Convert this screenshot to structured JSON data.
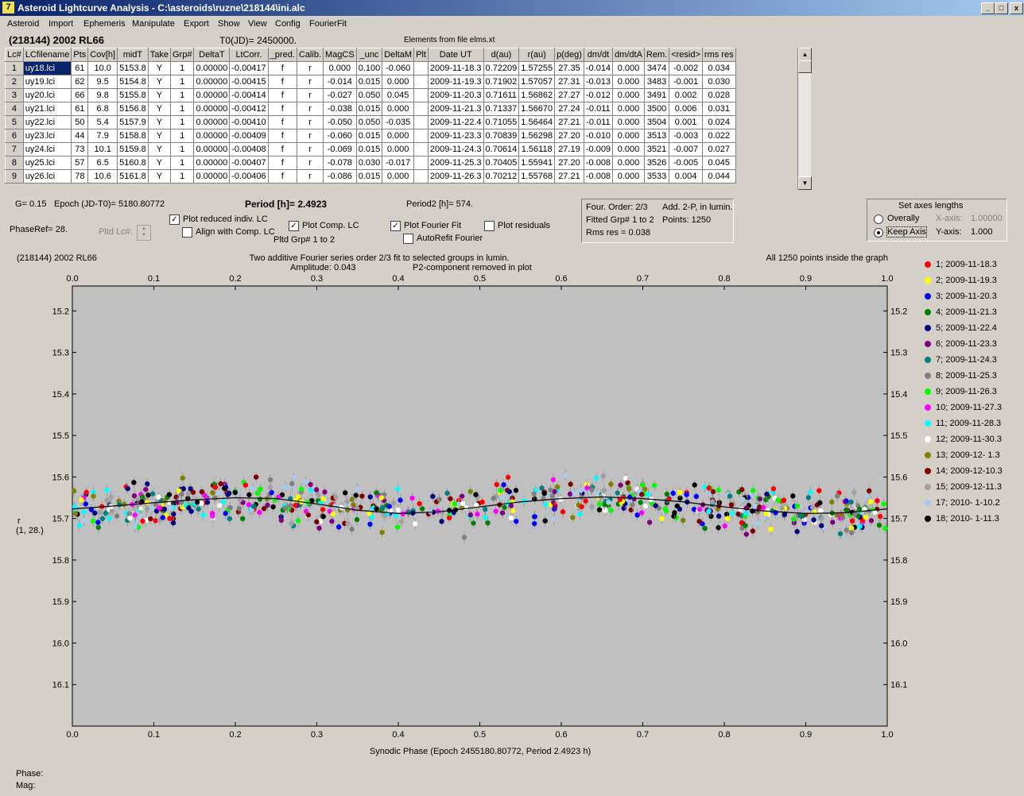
{
  "window": {
    "title": "Asteroid Lightcurve Analysis - C:\\asteroids\\ruzne\\218144\\ini.alc",
    "min": "_",
    "max": "□",
    "close": "x"
  },
  "menu": [
    "Asteroid",
    "Import",
    "Ephemeris",
    "Manipulate",
    "Export",
    "Show",
    "View",
    "Config",
    "FourierFit"
  ],
  "header": {
    "asteroid": "(218144) 2002 RL66",
    "t0": "T0(JD)= 2450000.",
    "elements": "Elements from file elms.xt"
  },
  "table": {
    "columns": [
      "Lc#",
      "LCfilename",
      "Pts",
      "Cov[h]",
      "midT",
      "Take",
      "Grp#",
      "DeltaT",
      "LtCorr.",
      "_pred.",
      "Calib.",
      "MagCS",
      "_unc",
      "DeltaM",
      "Plt",
      "Date UT",
      "d(au)",
      "r(au)",
      "p(deg)",
      "dm/dt",
      "dm/dtA",
      "Rem.",
      "<resid>",
      "rms res"
    ],
    "rows": [
      [
        "1",
        "uy18.lci",
        "61",
        "10.0",
        "5153.8",
        "Y",
        "1",
        "0.00000",
        "-0.00417",
        "f",
        "r",
        "0.000",
        "0.100",
        "-0.060",
        "",
        "2009-11-18.3",
        "0.72209",
        "1.57255",
        "27.35",
        "-0.014",
        "0.000",
        "3474",
        "-0.002",
        "0.034"
      ],
      [
        "2",
        "uy19.lci",
        "62",
        "9.5",
        "5154.8",
        "Y",
        "1",
        "0.00000",
        "-0.00415",
        "f",
        "r",
        "-0.014",
        "0.015",
        "0.000",
        "",
        "2009-11-19.3",
        "0.71902",
        "1.57057",
        "27.31",
        "-0.013",
        "0.000",
        "3483",
        "-0.001",
        "0.030"
      ],
      [
        "3",
        "uy20.lci",
        "66",
        "9.8",
        "5155.8",
        "Y",
        "1",
        "0.00000",
        "-0.00414",
        "f",
        "r",
        "-0.027",
        "0.050",
        "0.045",
        "",
        "2009-11-20.3",
        "0.71611",
        "1.56862",
        "27.27",
        "-0.012",
        "0.000",
        "3491",
        "0.002",
        "0.028"
      ],
      [
        "4",
        "uy21.lci",
        "61",
        "6.8",
        "5156.8",
        "Y",
        "1",
        "0.00000",
        "-0.00412",
        "f",
        "r",
        "-0.038",
        "0.015",
        "0.000",
        "",
        "2009-11-21.3",
        "0.71337",
        "1.56670",
        "27.24",
        "-0.011",
        "0.000",
        "3500",
        "0.006",
        "0.031"
      ],
      [
        "5",
        "uy22.lci",
        "50",
        "5.4",
        "5157.9",
        "Y",
        "1",
        "0.00000",
        "-0.00410",
        "f",
        "r",
        "-0.050",
        "0.050",
        "-0.035",
        "",
        "2009-11-22.4",
        "0.71055",
        "1.56464",
        "27.21",
        "-0.011",
        "0.000",
        "3504",
        "0.001",
        "0.024"
      ],
      [
        "6",
        "uy23.lci",
        "44",
        "7.9",
        "5158.8",
        "Y",
        "1",
        "0.00000",
        "-0.00409",
        "f",
        "r",
        "-0.060",
        "0.015",
        "0.000",
        "",
        "2009-11-23.3",
        "0.70839",
        "1.56298",
        "27.20",
        "-0.010",
        "0.000",
        "3513",
        "-0.003",
        "0.022"
      ],
      [
        "7",
        "uy24.lci",
        "73",
        "10.1",
        "5159.8",
        "Y",
        "1",
        "0.00000",
        "-0.00408",
        "f",
        "r",
        "-0.069",
        "0.015",
        "0.000",
        "",
        "2009-11-24.3",
        "0.70614",
        "1.56118",
        "27.19",
        "-0.009",
        "0.000",
        "3521",
        "-0.007",
        "0.027"
      ],
      [
        "8",
        "uy25.lci",
        "57",
        "6.5",
        "5160.8",
        "Y",
        "1",
        "0.00000",
        "-0.00407",
        "f",
        "r",
        "-0.078",
        "0.030",
        "-0.017",
        "",
        "2009-11-25.3",
        "0.70405",
        "1.55941",
        "27.20",
        "-0.008",
        "0.000",
        "3526",
        "-0.005",
        "0.045"
      ],
      [
        "9",
        "uy26.lci",
        "78",
        "10.6",
        "5161.8",
        "Y",
        "1",
        "0.00000",
        "-0.00406",
        "f",
        "r",
        "-0.086",
        "0.015",
        "0.000",
        "",
        "2009-11-26.3",
        "0.70212",
        "1.55768",
        "27.21",
        "-0.008",
        "0.000",
        "3533",
        "0.004",
        "0.044"
      ]
    ]
  },
  "info": {
    "g": "G= 0.15",
    "epoch": "Epoch (JD-T0)= 5180.80772",
    "period": "Period [h]= 2.4923",
    "period2": "Period2 [h]= 574.",
    "phaseref": "PhaseRef= 28.",
    "pltd_lc": "Pltd Lc#:",
    "pltd_grp": "Pltd Grp#  1   to   2",
    "plot_reduced": "Plot reduced indiv. LC",
    "align": "Align with Comp. LC",
    "plot_comp": "Plot Comp. LC",
    "plot_fourier": "Plot Fourier Fit",
    "autorefit": "AutoRefit Fourier",
    "plot_resid": "Plot residuals",
    "four_order": "Four. Order:  2/3",
    "add2p": "Add. 2-P, in lumin.",
    "fitted": "Fitted Grp# 1 to 2",
    "points": "Points: 1250",
    "rms": "Rms res     = 0.038"
  },
  "axes_box": {
    "title": "Set axes lengths",
    "overally": "Overally",
    "keep": "Keep Axis",
    "xaxis": "X-axis:",
    "xval": "1.00000",
    "yaxis": "Y-axis:",
    "yval": "1.000"
  },
  "chart_data": {
    "type": "scatter",
    "title_left": "(218144) 2002 RL66",
    "title": "Two additive Fourier series order 2/3 fit to selected groups in lumin.",
    "amplitude": "Amplitude: 0.043",
    "p2": "P2-component removed in plot",
    "note": "All 1250 points inside the graph",
    "xlabel": "Synodic Phase (Epoch 2455180.80772, Period 2.4923 h)",
    "ylabel": "r",
    "ylabel2": "(1, 28.)",
    "xlim": [
      0,
      1
    ],
    "ylim": [
      15.8,
      15.15
    ],
    "xticks": [
      "0.0",
      "0.1",
      "0.2",
      "0.3",
      "0.4",
      "0.5",
      "0.6",
      "0.7",
      "0.8",
      "0.9",
      "1.0"
    ],
    "yticks": [
      "15.2",
      "15.3",
      "15.4",
      "15.5",
      "15.6",
      "15.7",
      "15.8",
      "15.9",
      "16.0",
      "16.1"
    ],
    "fit_curve": {
      "x": [
        0,
        0.05,
        0.1,
        0.15,
        0.2,
        0.25,
        0.3,
        0.35,
        0.4,
        0.45,
        0.5,
        0.55,
        0.6,
        0.65,
        0.7,
        0.75,
        0.8,
        0.85,
        0.9,
        0.95,
        1.0
      ],
      "y": [
        15.677,
        15.67,
        15.662,
        15.655,
        15.65,
        15.652,
        15.665,
        15.68,
        15.688,
        15.684,
        15.672,
        15.66,
        15.652,
        15.648,
        15.652,
        15.66,
        15.672,
        15.682,
        15.688,
        15.686,
        15.677
      ]
    },
    "series": [
      {
        "name": "1; 2009-11-18.3",
        "color": "#ff0000"
      },
      {
        "name": "2; 2009-11-19.3",
        "color": "#ffff00"
      },
      {
        "name": "3; 2009-11-20.3",
        "color": "#0000ff"
      },
      {
        "name": "4; 2009-11-21.3",
        "color": "#008000"
      },
      {
        "name": "5; 2009-11-22.4",
        "color": "#000080"
      },
      {
        "name": "6; 2009-11-23.3",
        "color": "#800080"
      },
      {
        "name": "7; 2009-11-24.3",
        "color": "#008080"
      },
      {
        "name": "8; 2009-11-25.3",
        "color": "#808080"
      },
      {
        "name": "9; 2009-11-26.3",
        "color": "#00ff00"
      },
      {
        "name": "10; 2009-11-27.3",
        "color": "#ff00ff"
      },
      {
        "name": "11; 2009-11-28.3",
        "color": "#00ffff"
      },
      {
        "name": "12; 2009-11-30.3",
        "color": "#ffffff"
      },
      {
        "name": "13; 2009-12- 1.3",
        "color": "#808000"
      },
      {
        "name": "14; 2009-12-10.3",
        "color": "#800000"
      },
      {
        "name": "15; 2009-12-11.3",
        "color": "#a0a0a0"
      },
      {
        "name": "17; 2010- 1-10.2",
        "color": "#a6caf0"
      },
      {
        "name": "18; 2010- 1-11.3",
        "color": "#000000"
      }
    ]
  },
  "footer": {
    "phase": "Phase:",
    "mag": "Mag:"
  }
}
